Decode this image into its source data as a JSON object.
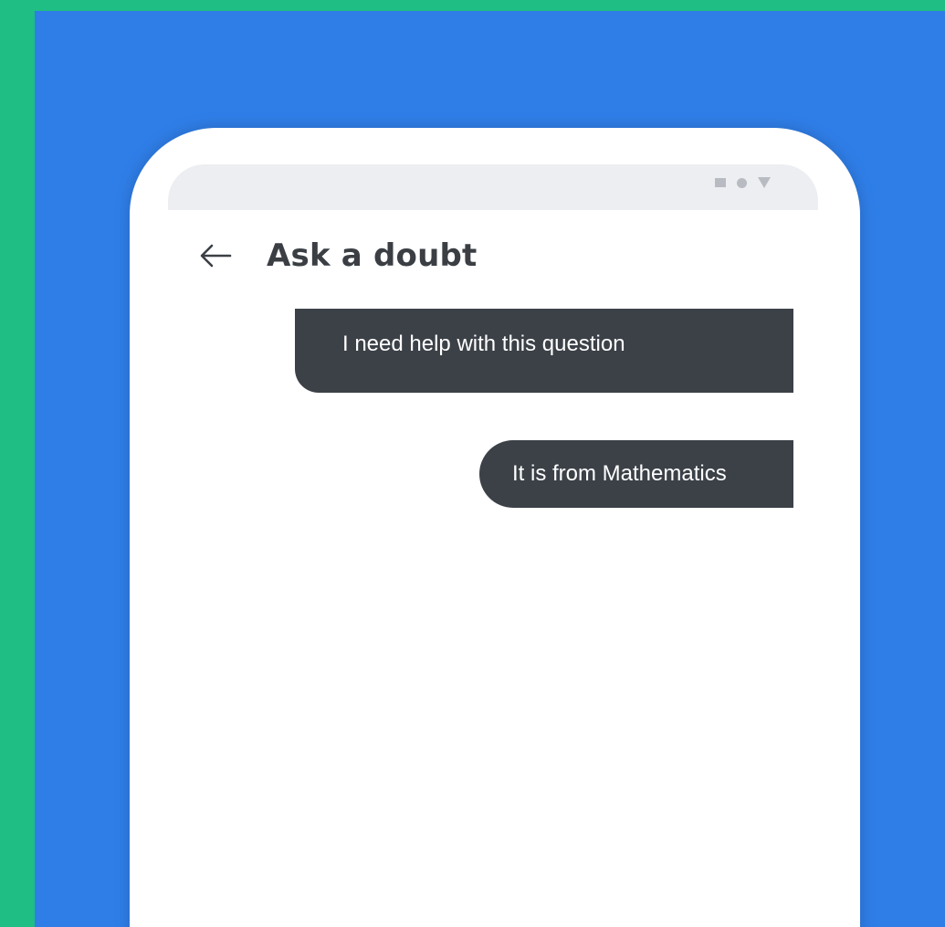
{
  "app": {
    "title": "Ask a doubt"
  },
  "header": {
    "back_icon": "arrow-left-icon"
  },
  "status_bar": {
    "icons": [
      "square-icon",
      "dot-icon",
      "triangle-icon"
    ]
  },
  "messages": [
    {
      "text": "I need help with this question",
      "sender": "user"
    },
    {
      "text": "It is from Mathematics",
      "sender": "user"
    }
  ],
  "colors": {
    "green_background": "#1fbe84",
    "blue_panel": "#2f7ee8",
    "bubble": "#3c4148",
    "title_text": "#3b3f44"
  }
}
